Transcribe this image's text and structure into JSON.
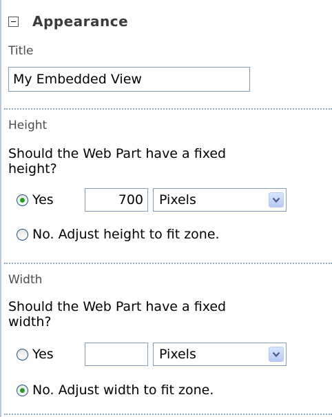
{
  "appearance": {
    "section_title": "Appearance",
    "title_label": "Title",
    "title_value": "My Embedded View"
  },
  "height": {
    "label": "Height",
    "question_line1": "Should the Web Part have a fixed",
    "question_line2": "height?",
    "yes_label": "Yes",
    "yes_checked": true,
    "value": "700",
    "unit": "Pixels",
    "no_label": "No. Adjust height to fit zone.",
    "no_checked": false
  },
  "width": {
    "label": "Width",
    "question_line1": "Should the Web Part have a fixed",
    "question_line2": "width?",
    "yes_label": "Yes",
    "yes_checked": false,
    "value": "",
    "unit": "Pixels",
    "no_label": "No. Adjust width to fit zone.",
    "no_checked": true
  },
  "colors": {
    "divider": "#8aa7c9",
    "radio_dot": "#21a121",
    "input_border": "#7f9db9"
  },
  "icons": {
    "collapse": "collapse-minus-icon",
    "dropdown": "chevron-down-icon"
  }
}
